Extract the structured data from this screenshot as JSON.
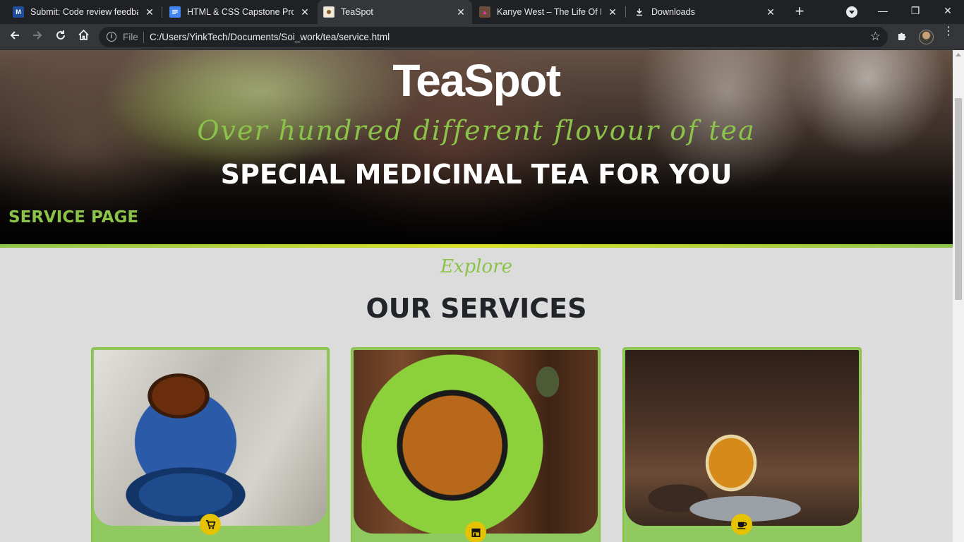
{
  "browser": {
    "tabs": [
      {
        "title": "Submit: Code review feedback",
        "favicon": "microverse-icon",
        "active": false
      },
      {
        "title": "HTML & CSS Capstone Project",
        "favicon": "google-docs-icon",
        "active": false
      },
      {
        "title": "TeaSpot",
        "favicon": "teaspot-icon",
        "active": true
      },
      {
        "title": "Kanye West – The Life Of Pablo",
        "favicon": "album-icon",
        "active": false
      },
      {
        "title": "Downloads",
        "favicon": "download-icon",
        "active": false
      }
    ],
    "address": {
      "scheme_label": "File",
      "url": "C:/Users/YinkTech/Documents/Soi_work/tea/service.html"
    }
  },
  "hero": {
    "brand": "TeaSpot",
    "tagline": "Over hundred different flovour of tea",
    "headline": "SPECIAL MEDICINAL TEA FOR YOU",
    "page_label": "SERVICE PAGE"
  },
  "services": {
    "kicker": "Explore",
    "title": "OUR SERVICES",
    "cards": [
      {
        "image": "tea-bag-blue-cup-photo",
        "icon": "shopping-cart-icon"
      },
      {
        "image": "green-tea-cup-photo",
        "icon": "store-icon"
      },
      {
        "image": "herbal-tea-glass-photo",
        "icon": "coffee-cup-icon"
      }
    ]
  },
  "colors": {
    "accent_green": "#8bc34a",
    "badge_yellow": "#e6c300",
    "title_dark": "#212529",
    "page_bg": "#dcdcdc"
  }
}
